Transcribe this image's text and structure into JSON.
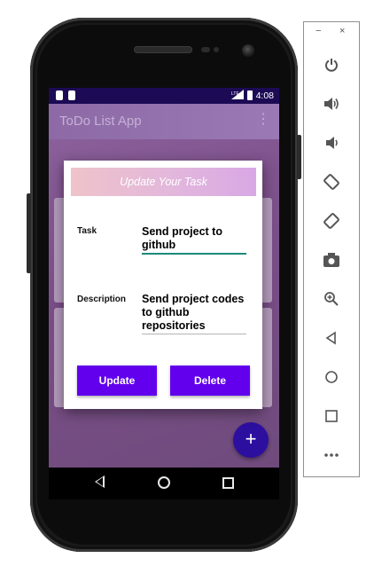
{
  "app": {
    "title": "ToDo List App",
    "menu_icon": "overflow-menu-icon"
  },
  "status_bar": {
    "time": "4:08",
    "signal_label": "LTE"
  },
  "dialog": {
    "title": "Update Your Task",
    "task_label": "Task",
    "task_value": "Send project to github",
    "description_label": "Description",
    "description_value": "Send project codes to github repositories",
    "update_button": "Update",
    "delete_button": "Delete"
  },
  "fab": {
    "label": "+"
  },
  "emulator_panel": {
    "minimize": "−",
    "close": "×",
    "buttons": [
      "power-icon",
      "volume-up-icon",
      "volume-down-icon",
      "rotate-left-icon",
      "rotate-right-icon",
      "camera-icon",
      "zoom-icon",
      "back-icon",
      "home-icon",
      "overview-icon",
      "more-icon"
    ]
  },
  "colors": {
    "status_bar": "#1c0a55",
    "accent_button": "#6200ee",
    "fab": "#2d0fa0",
    "task_underline": "#1a8a7a"
  }
}
